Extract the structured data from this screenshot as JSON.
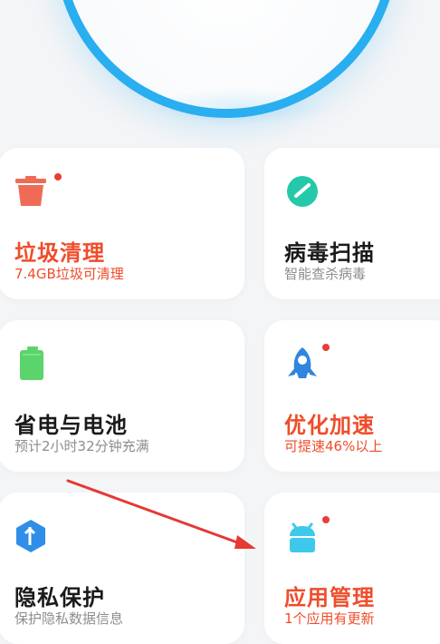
{
  "colors": {
    "ring": "#29aef0",
    "alert": "#ef4d2b",
    "dot": "#ea3d33",
    "trash_icon": "#f06b55",
    "virus_icon": "#25c9a9",
    "battery_icon": "#5ad46b",
    "privacy_icon": "#2e8ee8",
    "boost_icon": "#2e86de",
    "apps_icon": "#3cc9ec",
    "annotation_arrow": "#e53935"
  },
  "cards": [
    {
      "id": "trash",
      "icon": "trash-icon",
      "title": "垃圾清理",
      "subtitle": "7.4GB垃圾可清理",
      "has_notification_dot": true
    },
    {
      "id": "virus",
      "icon": "virus-scan-icon",
      "title": "病毒扫描",
      "subtitle": "智能查杀病毒",
      "has_notification_dot": false
    },
    {
      "id": "battery",
      "icon": "battery-icon",
      "title": "省电与电池",
      "subtitle": "预计2小时32分钟充满",
      "has_notification_dot": false
    },
    {
      "id": "boost",
      "icon": "rocket-icon",
      "title": "优化加速",
      "subtitle": "可提速46%以上",
      "has_notification_dot": true
    },
    {
      "id": "privacy",
      "icon": "privacy-shield-icon",
      "title": "隐私保护",
      "subtitle": "保护隐私数据信息",
      "has_notification_dot": false
    },
    {
      "id": "apps",
      "icon": "android-app-icon",
      "title": "应用管理",
      "subtitle": "1个应用有更新",
      "has_notification_dot": true
    }
  ]
}
